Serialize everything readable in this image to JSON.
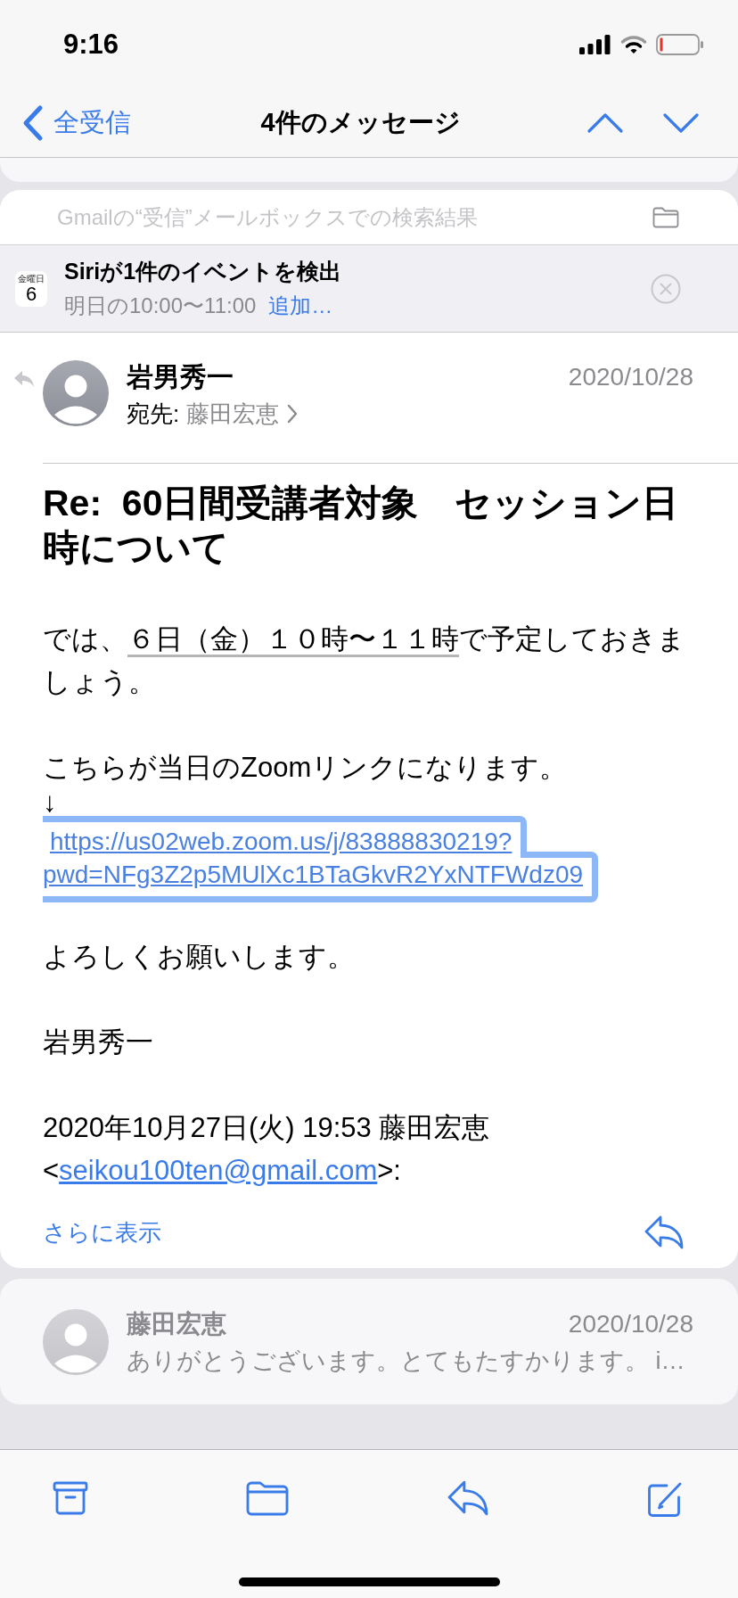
{
  "status_bar": {
    "time": "9:16"
  },
  "nav_bar": {
    "back_label": "全受信",
    "title": "4件のメッセージ"
  },
  "mailbox_note": "Gmailの“受信”メールボックスでの検索結果",
  "siri_suggestion": {
    "calendar_weekday": "金曜日",
    "calendar_day": "6",
    "title": "Siriが1件のイベントを検出",
    "time": "明日の10:00〜11:00",
    "action": "追加…"
  },
  "messages": [
    {
      "kind": "expanded",
      "replied": true,
      "sender": "岩男秀一",
      "date": "2020/10/28",
      "recipient_label": "宛先:",
      "recipient": "藤田宏恵",
      "subject": "Re:  60日間受講者対象　セッション日時について",
      "body": [
        {
          "kind": "paragraph",
          "parts": [
            {
              "kind": "text",
              "text": "では、"
            },
            {
              "kind": "detected_date",
              "text": "６日（金）１０時〜１１時"
            },
            {
              "kind": "text",
              "text": "で予定しておきましょう。"
            }
          ]
        },
        {
          "kind": "paragraph",
          "parts": [
            {
              "kind": "text",
              "text": "こちらが当日のZoomリンクになります。"
            }
          ]
        },
        {
          "kind": "line",
          "parts": [
            {
              "kind": "text",
              "text": "↓"
            }
          ]
        },
        {
          "kind": "highlighted_link",
          "lines": [
            "https://us02web.zoom.us/j/83888830219?",
            "pwd=NFg3Z2p5MUlXc1BTaGkvR2YxNTFWdz09"
          ]
        },
        {
          "kind": "paragraph",
          "parts": [
            {
              "kind": "text",
              "text": "よろしくお願いします。"
            }
          ]
        },
        {
          "kind": "paragraph",
          "parts": [
            {
              "kind": "text",
              "text": "岩男秀一"
            }
          ]
        },
        {
          "kind": "paragraph",
          "parts": [
            {
              "kind": "text",
              "text": "2020年10月27日(火) 19:53 藤田宏恵"
            },
            {
              "kind": "break"
            },
            {
              "kind": "text",
              "text": "<"
            },
            {
              "kind": "email_link",
              "text": "seikou100ten@gmail.com"
            },
            {
              "kind": "text",
              "text": ">:"
            }
          ]
        }
      ],
      "more": "さらに表示"
    },
    {
      "kind": "collapsed",
      "replied": false,
      "sender": "藤田宏恵",
      "date": "2020/10/28",
      "preview": "ありがとうございます。とてもたすかります。 i…"
    }
  ]
}
